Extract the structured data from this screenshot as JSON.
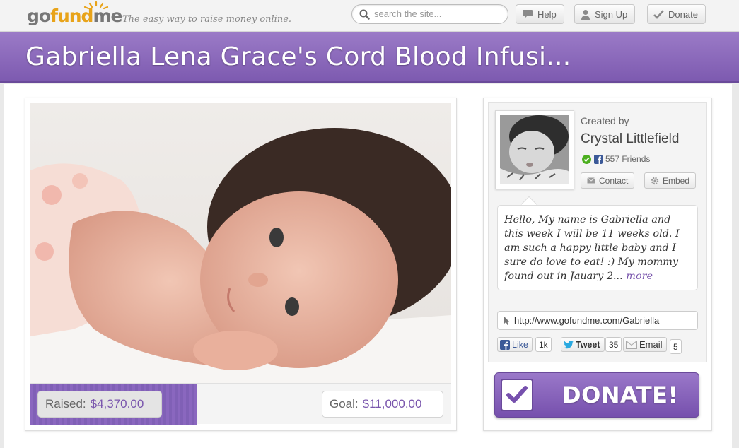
{
  "header": {
    "logo": {
      "part1": "go",
      "part2": "fund",
      "part3": "me"
    },
    "tagline": "The easy way to raise money online.",
    "search": {
      "placeholder": "search the site..."
    },
    "buttons": {
      "help": "Help",
      "signup": "Sign Up",
      "donate": "Donate"
    }
  },
  "campaign": {
    "title": "Gabriella Lena Grace's Cord Blood Infusi...",
    "raised_label": "Raised:",
    "raised_value": "$4,370.00",
    "goal_label": "Goal:",
    "goal_value": "$11,000.00",
    "progress_fraction": 0.397
  },
  "creator": {
    "created_by_label": "Created by",
    "name": "Crystal Littlefield",
    "friends": "557 Friends",
    "contact_label": "Contact",
    "embed_label": "Embed"
  },
  "story": {
    "excerpt": "Hello,   My name is Gabriella and this week I will be 11 weeks old. I am such a happy little baby and I sure do love to eat! :) My mommy found out in Jauary 2...",
    "more_label": "more"
  },
  "share": {
    "url": "http://www.gofundme.com/Gabriella",
    "like_label": "Like",
    "like_count": "1k",
    "tweet_label": "Tweet",
    "tweet_count": "35",
    "email_label": "Email",
    "email_count": "5"
  },
  "donate_button": {
    "label": "DONATE!"
  },
  "colors": {
    "brand_purple": "#8a67bf",
    "logo_orange": "#e8a319",
    "facebook_blue": "#3b5998",
    "twitter_blue": "#2aa9e0"
  }
}
